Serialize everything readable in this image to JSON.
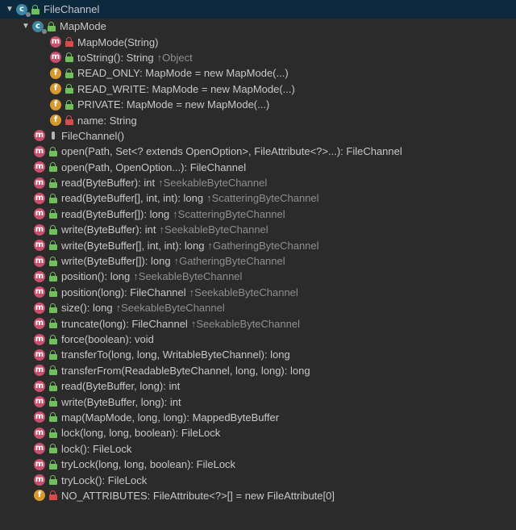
{
  "tree": {
    "root": {
      "label": "FileChannel",
      "expanded": true,
      "icon": "class-icon",
      "access": "public"
    },
    "mapmode": {
      "label": "MapMode",
      "expanded": true,
      "icon": "class-icon",
      "access": "public",
      "items": [
        {
          "label": "MapMode(String)",
          "icon": "method-icon",
          "access": "private",
          "inherited": ""
        },
        {
          "label": "toString(): String",
          "icon": "method-icon",
          "access": "public",
          "inherited": "↑Object"
        },
        {
          "label": "READ_ONLY: MapMode = new MapMode(...)",
          "icon": "field-icon",
          "access": "public",
          "inherited": ""
        },
        {
          "label": "READ_WRITE: MapMode = new MapMode(...)",
          "icon": "field-icon",
          "access": "public",
          "inherited": ""
        },
        {
          "label": "PRIVATE: MapMode = new MapMode(...)",
          "icon": "field-icon",
          "access": "public",
          "inherited": ""
        },
        {
          "label": "name: String",
          "icon": "field-icon",
          "access": "private",
          "inherited": ""
        }
      ]
    },
    "members": [
      {
        "label": "FileChannel()",
        "icon": "method-icon",
        "access": "package",
        "inherited": ""
      },
      {
        "label": "open(Path, Set<? extends OpenOption>, FileAttribute<?>...): FileChannel",
        "icon": "method-icon",
        "access": "public",
        "inherited": ""
      },
      {
        "label": "open(Path, OpenOption...): FileChannel",
        "icon": "method-icon",
        "access": "public",
        "inherited": ""
      },
      {
        "label": "read(ByteBuffer): int",
        "icon": "method-icon",
        "access": "public",
        "inherited": "↑SeekableByteChannel"
      },
      {
        "label": "read(ByteBuffer[], int, int): long",
        "icon": "method-icon",
        "access": "public",
        "inherited": "↑ScatteringByteChannel"
      },
      {
        "label": "read(ByteBuffer[]): long",
        "icon": "method-icon",
        "access": "public",
        "inherited": "↑ScatteringByteChannel"
      },
      {
        "label": "write(ByteBuffer): int",
        "icon": "method-icon",
        "access": "public",
        "inherited": "↑SeekableByteChannel"
      },
      {
        "label": "write(ByteBuffer[], int, int): long",
        "icon": "method-icon",
        "access": "public",
        "inherited": "↑GatheringByteChannel"
      },
      {
        "label": "write(ByteBuffer[]): long",
        "icon": "method-icon",
        "access": "public",
        "inherited": "↑GatheringByteChannel"
      },
      {
        "label": "position(): long",
        "icon": "method-icon",
        "access": "public",
        "inherited": "↑SeekableByteChannel"
      },
      {
        "label": "position(long): FileChannel",
        "icon": "method-icon",
        "access": "public",
        "inherited": "↑SeekableByteChannel"
      },
      {
        "label": "size(): long",
        "icon": "method-icon",
        "access": "public",
        "inherited": "↑SeekableByteChannel"
      },
      {
        "label": "truncate(long): FileChannel",
        "icon": "method-icon",
        "access": "public",
        "inherited": "↑SeekableByteChannel"
      },
      {
        "label": "force(boolean): void",
        "icon": "method-icon",
        "access": "public",
        "inherited": ""
      },
      {
        "label": "transferTo(long, long, WritableByteChannel): long",
        "icon": "method-icon",
        "access": "public",
        "inherited": ""
      },
      {
        "label": "transferFrom(ReadableByteChannel, long, long): long",
        "icon": "method-icon",
        "access": "public",
        "inherited": ""
      },
      {
        "label": "read(ByteBuffer, long): int",
        "icon": "method-icon",
        "access": "public",
        "inherited": ""
      },
      {
        "label": "write(ByteBuffer, long): int",
        "icon": "method-icon",
        "access": "public",
        "inherited": ""
      },
      {
        "label": "map(MapMode, long, long): MappedByteBuffer",
        "icon": "method-icon",
        "access": "public",
        "inherited": ""
      },
      {
        "label": "lock(long, long, boolean): FileLock",
        "icon": "method-icon",
        "access": "public",
        "inherited": ""
      },
      {
        "label": "lock(): FileLock",
        "icon": "method-icon",
        "access": "public",
        "inherited": ""
      },
      {
        "label": "tryLock(long, long, boolean): FileLock",
        "icon": "method-icon",
        "access": "public",
        "inherited": ""
      },
      {
        "label": "tryLock(): FileLock",
        "icon": "method-icon",
        "access": "public",
        "inherited": ""
      },
      {
        "label": "NO_ATTRIBUTES: FileAttribute<?>[] = new FileAttribute[0]",
        "icon": "field-icon",
        "access": "private",
        "inherited": ""
      }
    ]
  },
  "colors": {
    "background": "#2b2b2b",
    "selected_row": "#0d293e",
    "method_icon": "#c94f6d",
    "field_icon": "#d89a2f",
    "class_icon": "#3e86a0",
    "public_lock": "#6fbf5a",
    "private_lock": "#d94a4a",
    "text": "#c8c8c8",
    "inherited_text": "#8f8f8f"
  }
}
